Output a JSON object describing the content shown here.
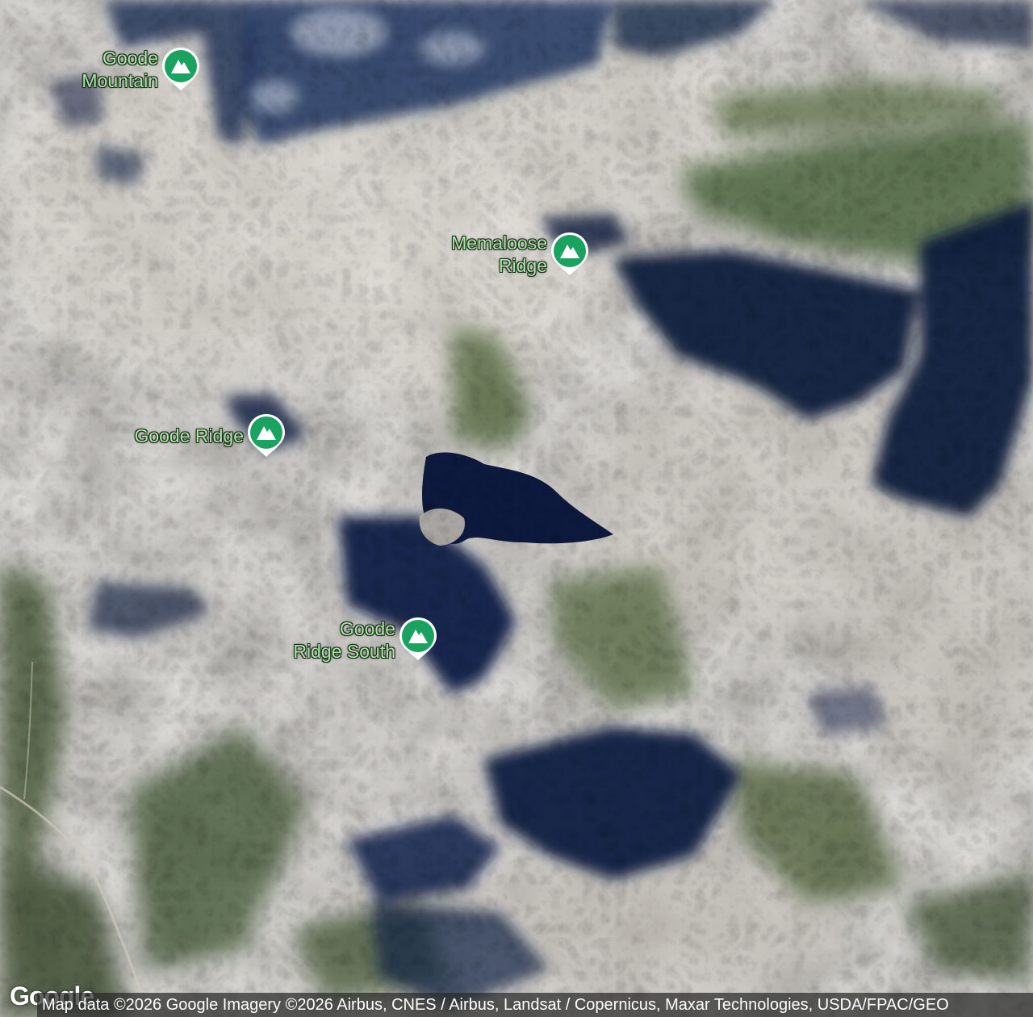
{
  "map": {
    "type": "satellite",
    "label_color": "#a8e6a3",
    "marker_color": "#1aa260"
  },
  "pois": [
    {
      "name": "Goode\nMountain",
      "icon": "mountain-peak-icon"
    },
    {
      "name": "Memaloose\nRidge",
      "icon": "mountain-peak-icon"
    },
    {
      "name": "Goode Ridge",
      "icon": "mountain-peak-icon"
    },
    {
      "name": "Goode\nRidge South",
      "icon": "mountain-peak-icon"
    }
  ],
  "footer": {
    "logo": "Google",
    "attribution": "Map data ©2026 Google Imagery ©2026 Airbus, CNES / Airbus, Landsat / Copernicus, Maxar Technologies, USDA/FPAC/GEO"
  }
}
